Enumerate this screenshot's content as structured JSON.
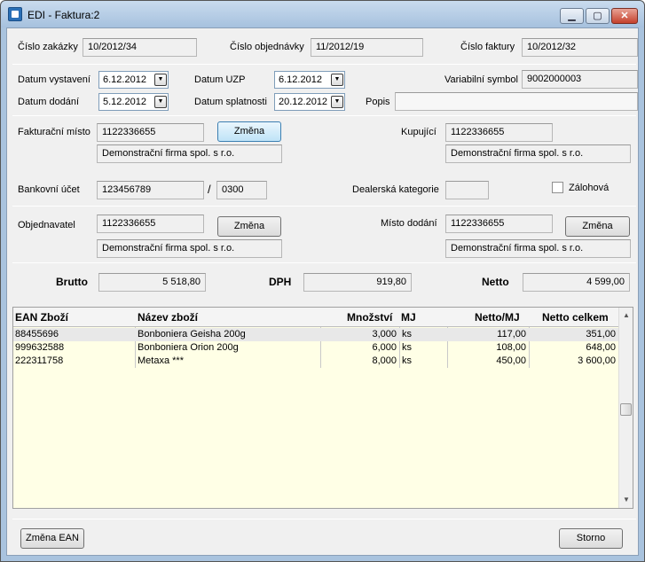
{
  "window": {
    "title": "EDI - Faktura:2"
  },
  "header": {
    "order_no_label": "Číslo zakázky",
    "order_no": "10/2012/34",
    "purchase_order_label": "Číslo objednávky",
    "purchase_order": "11/2012/19",
    "invoice_no_label": "Číslo faktury",
    "invoice_no": "10/2012/32"
  },
  "dates": {
    "issue_label": "Datum vystavení",
    "issue": "6.12.2012",
    "uzp_label": "Datum UZP",
    "uzp": "6.12.2012",
    "variable_symbol_label": "Variabilní symbol",
    "variable_symbol": "9002000003",
    "delivery_label": "Datum dodání",
    "delivery": "5.12.2012",
    "due_label": "Datum splatnosti",
    "due": "20.12.2012",
    "description_label": "Popis",
    "description": ""
  },
  "billing": {
    "place_label": "Fakturační místo",
    "place_code": "1122336655",
    "place_name": "Demonstrační firma spol. s r.o.",
    "change_label": "Změna",
    "buyer_label": "Kupující",
    "buyer_code": "1122336655",
    "buyer_name": "Demonstrační firma spol. s r.o."
  },
  "bank": {
    "account_label": "Bankovní účet",
    "account": "123456789",
    "slash": "/",
    "bank_code": "0300",
    "dealer_category_label": "Dealerská kategorie",
    "dealer_category": "",
    "advance_label": "Zálohová"
  },
  "orderer": {
    "label": "Objednavatel",
    "code": "1122336655",
    "name": "Demonstrační firma spol. s r.o.",
    "change_label": "Změna",
    "delivery_place_label": "Místo dodání",
    "delivery_code": "1122336655",
    "delivery_name": "Demonstrační firma spol. s r.o.",
    "delivery_change_label": "Změna"
  },
  "totals": {
    "gross_label": "Brutto",
    "gross": "5 518,80",
    "vat_label": "DPH",
    "vat": "919,80",
    "net_label": "Netto",
    "net": "4 599,00"
  },
  "table": {
    "columns": {
      "ean": "EAN Zboží",
      "name": "Název zboží",
      "qty": "Množství",
      "unit": "MJ",
      "net_per_unit": "Netto/MJ",
      "net_total": "Netto celkem"
    },
    "rows": [
      {
        "ean": "88455696",
        "name": "Bonboniera Geisha 200g",
        "qty": "3,000",
        "unit": "ks",
        "net_per_unit": "117,00",
        "net_total": "351,00"
      },
      {
        "ean": "999632588",
        "name": "Bonboniera Orion 200g",
        "qty": "6,000",
        "unit": "ks",
        "net_per_unit": "108,00",
        "net_total": "648,00"
      },
      {
        "ean": "222311758",
        "name": "Metaxa ***",
        "qty": "8,000",
        "unit": "ks",
        "net_per_unit": "450,00",
        "net_total": "3 600,00"
      }
    ]
  },
  "footer": {
    "change_ean_label": "Změna EAN",
    "cancel_label": "Storno"
  }
}
